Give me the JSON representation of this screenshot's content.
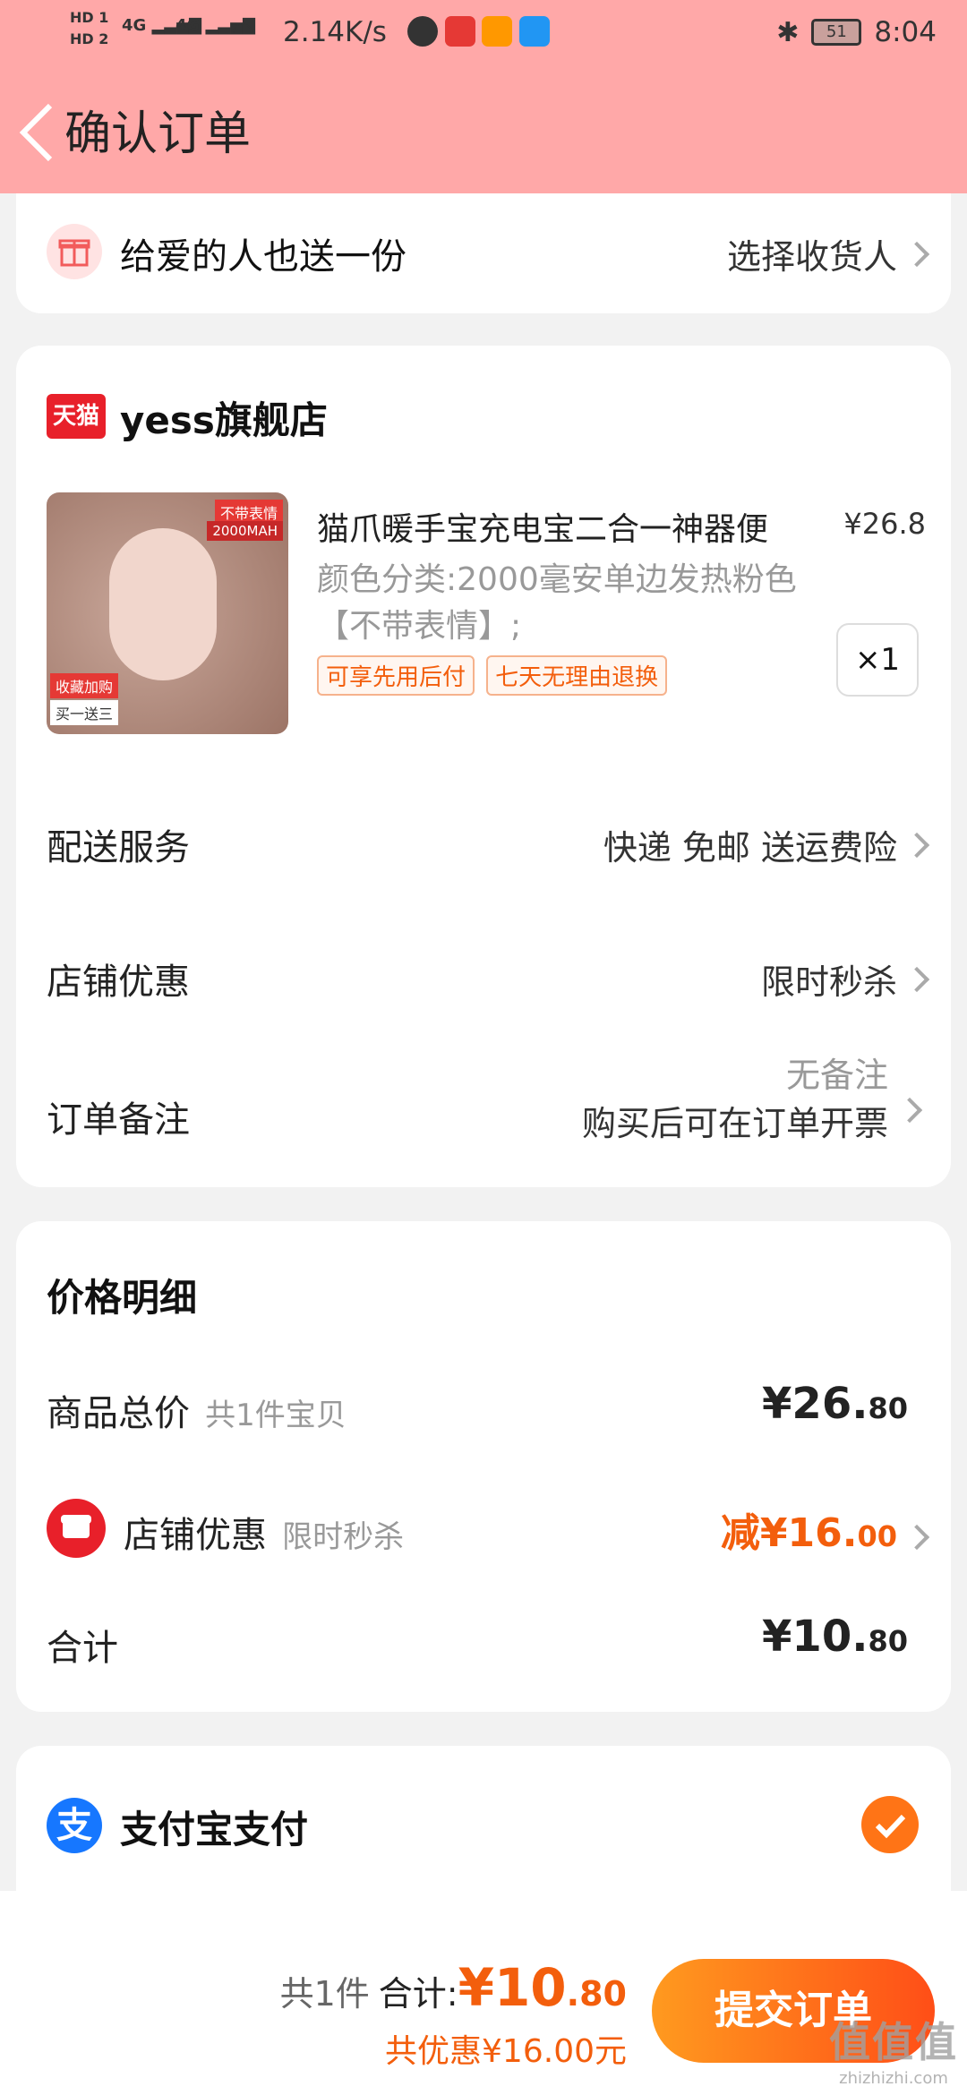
{
  "status_bar": {
    "hd1": "HD 1",
    "hd2": "HD 2",
    "net1": "4G",
    "net2": "4G",
    "speed": "2.14K/s",
    "battery": "51",
    "time": "8:04"
  },
  "header": {
    "title": "确认订单"
  },
  "gift": {
    "label": "给爱的人也送一份",
    "action": "选择收货人"
  },
  "store": {
    "badge": "天猫",
    "name": "yess旗舰店"
  },
  "product": {
    "image_tag1": "不带表情",
    "image_tag2": "2000MAH",
    "image_tag3": "收藏加购",
    "image_tag4": "买一送三",
    "title": "猫爪暖手宝充电宝二合一神器便",
    "price": "¥26.8",
    "spec": "颜色分类:2000毫安单边发热粉色【不带表情】;",
    "tags": [
      "可享先用后付",
      "七天无理由退换"
    ],
    "qty": "×1"
  },
  "services": {
    "delivery_label": "配送服务",
    "delivery_value": "快递 免邮 送运费险",
    "shop_discount_label": "店铺优惠",
    "shop_discount_value": "限时秒杀",
    "note_label": "订单备注",
    "note_value1": "无备注",
    "note_value2": "购买后可在订单开票"
  },
  "price_detail": {
    "title": "价格明细",
    "total_label": "商品总价",
    "total_sub": "共1件宝贝",
    "total_value_main": "¥26.",
    "total_value_dec": "80",
    "discount_label": "店铺优惠",
    "discount_sub": "限时秒杀",
    "discount_value_main": "减¥16.",
    "discount_value_dec": "00",
    "sum_label": "合计",
    "sum_value_main": "¥10.",
    "sum_value_dec": "80"
  },
  "payment": {
    "label": "支付宝支付"
  },
  "bottom": {
    "count": "共1件",
    "total_label": "合计:",
    "total_main": "¥10",
    "total_dec": ".80",
    "saved": "共优惠¥16.00元",
    "submit": "提交订单"
  },
  "watermark": {
    "big": "值值值",
    "small": "zhizhizhi.com"
  }
}
